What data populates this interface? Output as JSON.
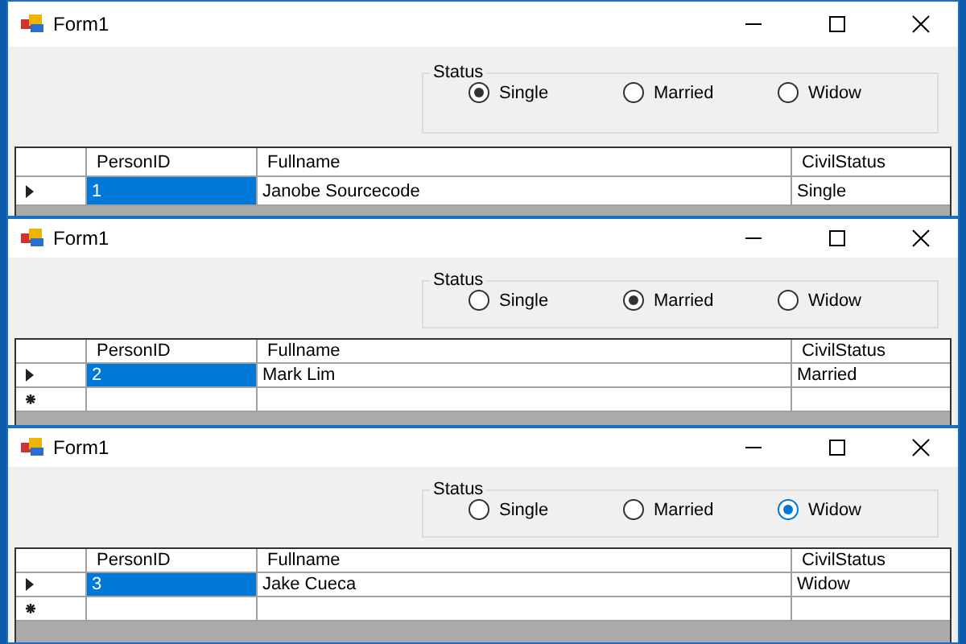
{
  "windows": [
    {
      "title": "Form1",
      "group_label": "Status",
      "options": [
        {
          "label": "Single",
          "selected": true
        },
        {
          "label": "Married",
          "selected": false
        },
        {
          "label": "Widow",
          "selected": false
        }
      ],
      "grid": {
        "columns": [
          "PersonID",
          "Fullname",
          "CivilStatus"
        ],
        "rows": [
          {
            "current": true,
            "cells": [
              {
                "text": "1",
                "selected": true
              },
              {
                "text": "Janobe Sourcecode",
                "selected": false
              },
              {
                "text": "Single",
                "selected": false
              }
            ]
          }
        ]
      }
    },
    {
      "title": "Form1",
      "group_label": "Status",
      "options": [
        {
          "label": "Single",
          "selected": false
        },
        {
          "label": "Married",
          "selected": true
        },
        {
          "label": "Widow",
          "selected": false
        }
      ],
      "grid": {
        "columns": [
          "PersonID",
          "Fullname",
          "CivilStatus"
        ],
        "rows": [
          {
            "current": true,
            "cells": [
              {
                "text": "2",
                "selected": true
              },
              {
                "text": "Mark Lim",
                "selected": false
              },
              {
                "text": "Married",
                "selected": false
              }
            ]
          }
        ],
        "new_row": true
      }
    },
    {
      "title": "Form1",
      "group_label": "Status",
      "options": [
        {
          "label": "Single",
          "selected": false
        },
        {
          "label": "Married",
          "selected": false
        },
        {
          "label": "Widow",
          "selected": true
        }
      ],
      "grid": {
        "columns": [
          "PersonID",
          "Fullname",
          "CivilStatus"
        ],
        "rows": [
          {
            "current": true,
            "cells": [
              {
                "text": "3",
                "selected": true
              },
              {
                "text": "Jake Cueca",
                "selected": false
              },
              {
                "text": "Widow",
                "selected": false
              }
            ]
          }
        ],
        "new_row": true
      }
    }
  ]
}
